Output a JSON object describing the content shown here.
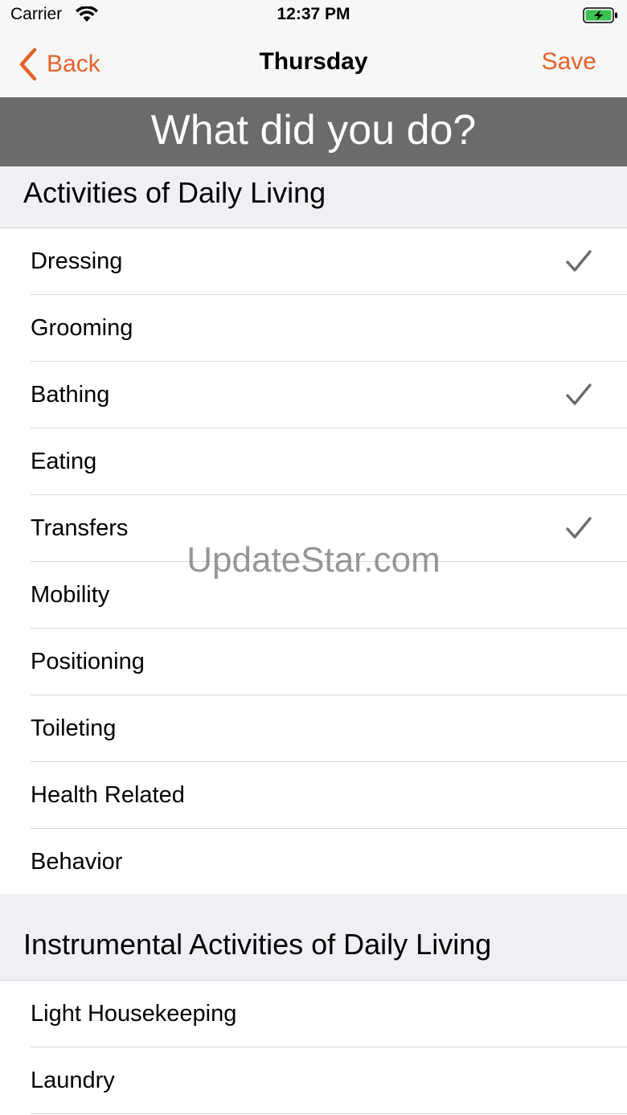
{
  "status_bar": {
    "carrier": "Carrier",
    "time": "12:37 PM"
  },
  "nav": {
    "back_label": "Back",
    "title": "Thursday",
    "save_label": "Save",
    "accent_color": "#e4622a"
  },
  "banner": {
    "text": "What did you do?",
    "background": "#6b6b6b"
  },
  "sections": [
    {
      "header": "Activities of Daily Living",
      "items": [
        {
          "label": "Dressing",
          "checked": true
        },
        {
          "label": "Grooming",
          "checked": false
        },
        {
          "label": "Bathing",
          "checked": true
        },
        {
          "label": "Eating",
          "checked": false
        },
        {
          "label": "Transfers",
          "checked": true
        },
        {
          "label": "Mobility",
          "checked": false
        },
        {
          "label": "Positioning",
          "checked": false
        },
        {
          "label": "Toileting",
          "checked": false
        },
        {
          "label": "Health Related",
          "checked": false
        },
        {
          "label": "Behavior",
          "checked": false
        }
      ]
    },
    {
      "header": "Instrumental Activities of Daily Living",
      "items": [
        {
          "label": "Light Housekeeping",
          "checked": false
        },
        {
          "label": "Laundry",
          "checked": false
        }
      ]
    }
  ],
  "watermark": "UpdateStar.com"
}
